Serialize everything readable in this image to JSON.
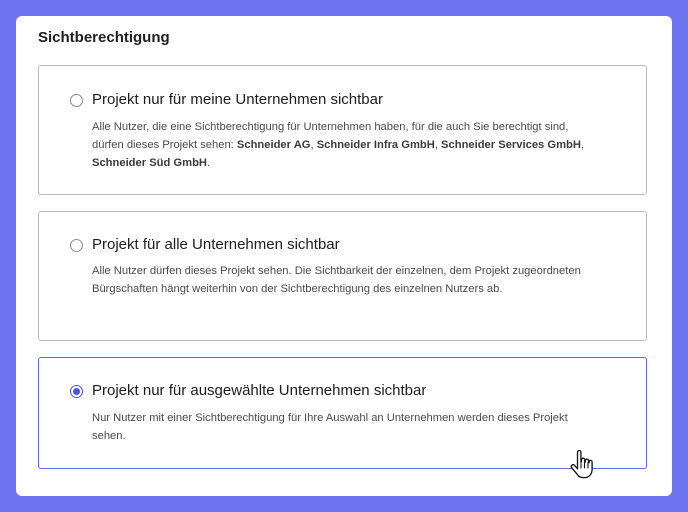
{
  "section": {
    "title": "Sichtberechtigung"
  },
  "options": [
    {
      "title": "Projekt nur für meine Unternehmen sichtbar",
      "description_prefix": "Alle Nutzer, die eine Sichtberechtigung für Unternehmen haben, für die auch Sie berechtigt sind, dürfen dieses Projekt sehen: ",
      "companies": [
        "Schneider AG",
        "Schneider Infra GmbH",
        "Schneider Services GmbH",
        "Schneider Süd GmbH"
      ],
      "separator": ", ",
      "description_suffix": ".",
      "selected": false
    },
    {
      "title": "Projekt für alle Unternehmen sichtbar",
      "description": "Alle Nutzer dürfen dieses Projekt sehen. Die Sichtbarkeit der einzelnen, dem Projekt zugeordneten Bürgschaften hängt weiterhin von der Sichtberechtigung des einzelnen Nutzers ab.",
      "selected": false
    },
    {
      "title": "Projekt nur für ausgewählte Unternehmen sichtbar",
      "description": "Nur Nutzer mit einer Sichtberechtigung für Ihre Auswahl an Unternehmen werden dieses Projekt sehen.",
      "selected": true
    }
  ],
  "colors": {
    "frame": "#6E73F2",
    "accent": "#4B53D9",
    "selected_border": "#6068E3"
  },
  "icons": {
    "cursor": "hand-pointer-icon"
  }
}
